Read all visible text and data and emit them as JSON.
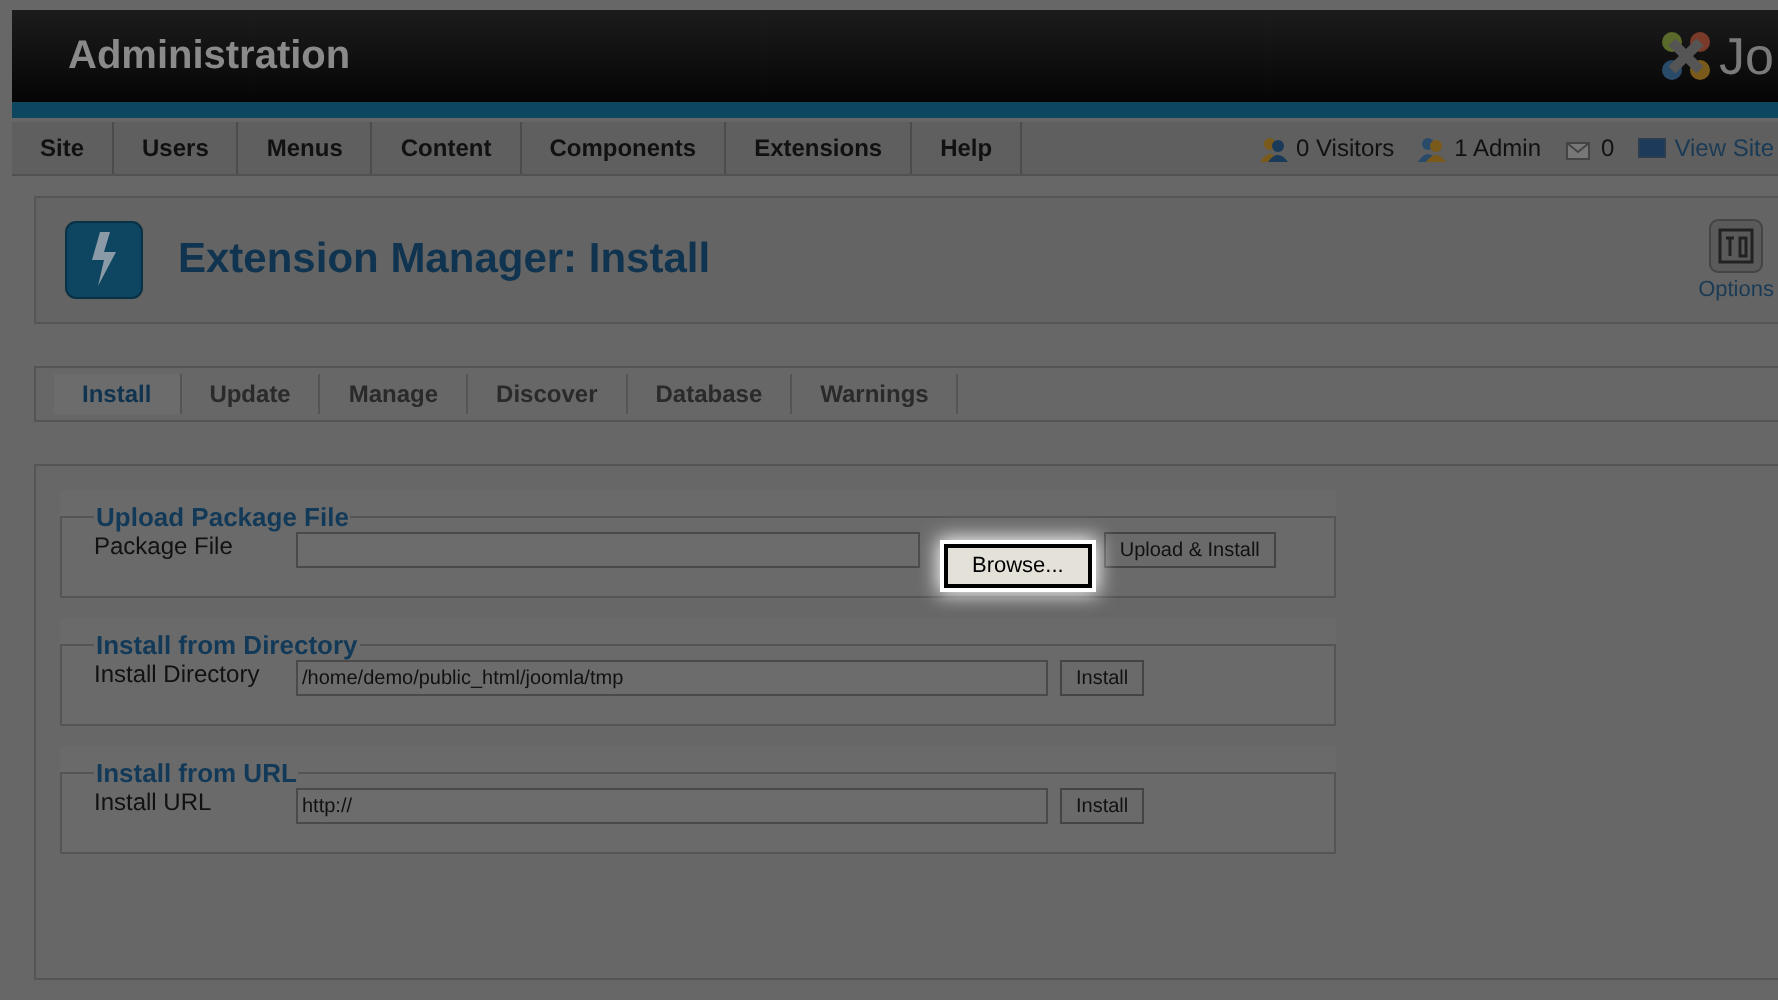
{
  "header": {
    "title": "Administration",
    "logo_text": "Jo"
  },
  "menu": {
    "items": [
      "Site",
      "Users",
      "Menus",
      "Content",
      "Components",
      "Extensions",
      "Help"
    ],
    "status": [
      {
        "kind": "visitors",
        "text": "0 Visitors"
      },
      {
        "kind": "admin",
        "text": "1 Admin"
      },
      {
        "kind": "messages",
        "text": "0"
      },
      {
        "kind": "view_site",
        "text": "View Site"
      }
    ]
  },
  "toolbar": {
    "title": "Extension Manager: Install",
    "options_label": "Options"
  },
  "tabs": [
    {
      "label": "Install",
      "selected": true
    },
    {
      "label": "Update",
      "selected": false
    },
    {
      "label": "Manage",
      "selected": false
    },
    {
      "label": "Discover",
      "selected": false
    },
    {
      "label": "Database",
      "selected": false
    },
    {
      "label": "Warnings",
      "selected": false
    }
  ],
  "sections": [
    {
      "legend": "Upload Package File",
      "label": "Package File",
      "buttons": [
        {
          "label": "Browse...",
          "highlighted": true
        },
        {
          "label": "Upload & Install",
          "highlighted": false
        }
      ]
    },
    {
      "legend": "Install from Directory",
      "label": "Install Directory",
      "value": "/home/demo/public_html/joomla/tmp",
      "buttons": [
        {
          "label": "Install",
          "highlighted": false
        }
      ]
    },
    {
      "legend": "Install from URL",
      "label": "Install URL",
      "value": "http://",
      "buttons": [
        {
          "label": "Install",
          "highlighted": false
        }
      ]
    }
  ]
}
